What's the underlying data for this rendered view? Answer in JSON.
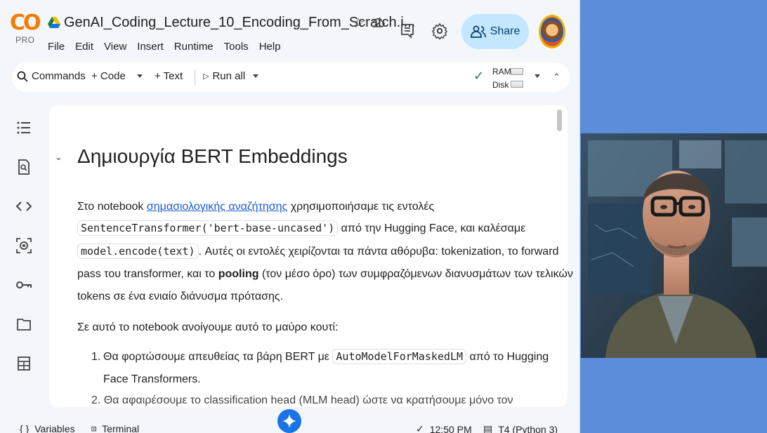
{
  "brand": {
    "logo_text": "CO",
    "tier": "PRO"
  },
  "header": {
    "notebook_title": "GenAI_Coding_Lecture_10_Encoding_From_Scratch.i...",
    "menus": [
      "File",
      "Edit",
      "View",
      "Insert",
      "Runtime",
      "Tools",
      "Help"
    ],
    "share_label": "Share"
  },
  "toolbar": {
    "commands": "Commands",
    "code": "+ Code",
    "text": "+ Text",
    "run_all": "Run all",
    "ram_label": "RAM",
    "disk_label": "Disk"
  },
  "sidebar": {
    "icons": [
      "toc-icon",
      "find-icon",
      "code-snippets-icon",
      "variables-inspector-icon",
      "secrets-key-icon",
      "files-folder-icon",
      "data-table-icon"
    ]
  },
  "cell": {
    "heading": "Δημιουργία BERT Embeddings",
    "p1_a": "Στο notebook ",
    "p1_link": "σημασιολογικής αναζήτησης",
    "p1_b": " χρησιμοποιήσαμε τις εντολές",
    "p1_code1": "SentenceTransformer('bert-base-uncased')",
    "p1_c": " από την Hugging Face, και καλέσαμε",
    "p1_code2": "model.encode(text)",
    "p1_d": ". Αυτές οι εντολές χειρίζονται τα πάντα αθόρυβα: tokenization, το forward",
    "p1_e": "pass του transformer, και το ",
    "p1_bold": "pooling",
    "p1_f": " (τον μέσο όρο) των συμφραζόμενων διανυσμάτων των τελικών",
    "p1_g": "tokens σε ένα ενιαίο διάνυσμα πρότασης.",
    "p2": "Σε αυτό το notebook ανοίγουμε αυτό το μαύρο κουτί:",
    "li1_num": "1.",
    "li1_a": "Θα φορτώσουμε απευθείας τα βάρη BERT με ",
    "li1_code": "AutoModelForMaskedLM",
    "li1_b": " από το Hugging",
    "li1_c": "Face Transformers.",
    "li2_partial": "2.  Θα αφαιρέσουμε το classification head (MLM head) ώστε να κρατήσουμε μόνο τον"
  },
  "status": {
    "variables": "Variables",
    "terminal": "Terminal",
    "time": "12:50 PM",
    "runtime": "T4 (Python 3)"
  },
  "colors": {
    "accent": "#1a73e8",
    "share_bg": "#c2e7ff",
    "desktop_bg": "#5b8ddb"
  }
}
